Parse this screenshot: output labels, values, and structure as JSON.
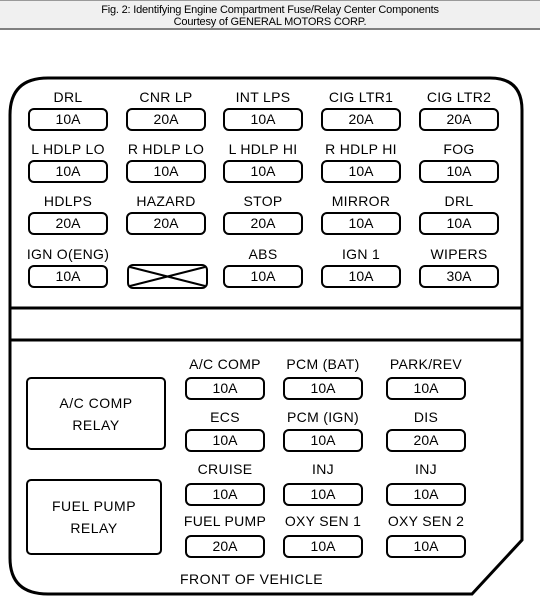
{
  "caption": {
    "title": "Fig. 2: Identifying Engine Compartment Fuse/Relay Center Components",
    "credit": "Courtesy of GENERAL MOTORS CORP."
  },
  "upper_fuses": [
    {
      "label": "DRL",
      "rating": "10A"
    },
    {
      "label": "CNR LP",
      "rating": "20A"
    },
    {
      "label": "INT LPS",
      "rating": "10A"
    },
    {
      "label": "CIG LTR1",
      "rating": "20A"
    },
    {
      "label": "CIG LTR2",
      "rating": "20A"
    },
    {
      "label": "L HDLP LO",
      "rating": "10A"
    },
    {
      "label": "R HDLP LO",
      "rating": "10A"
    },
    {
      "label": "L HDLP HI",
      "rating": "10A"
    },
    {
      "label": "R HDLP HI",
      "rating": "10A"
    },
    {
      "label": "FOG",
      "rating": "10A"
    },
    {
      "label": "HDLPS",
      "rating": "20A"
    },
    {
      "label": "HAZARD",
      "rating": "20A"
    },
    {
      "label": "STOP",
      "rating": "20A"
    },
    {
      "label": "MIRROR",
      "rating": "10A"
    },
    {
      "label": "DRL",
      "rating": "10A"
    },
    {
      "label": "IGN O(ENG)",
      "rating": "10A"
    },
    {
      "label": "",
      "rating": "",
      "empty": true
    },
    {
      "label": "ABS",
      "rating": "10A"
    },
    {
      "label": "IGN 1",
      "rating": "10A"
    },
    {
      "label": "WIPERS",
      "rating": "30A"
    }
  ],
  "lower_fuses": [
    {
      "label": "A/C COMP",
      "rating": "10A"
    },
    {
      "label": "PCM (BAT)",
      "rating": "10A"
    },
    {
      "label": "PARK/REV",
      "rating": "10A"
    },
    {
      "label": "ECS",
      "rating": "10A"
    },
    {
      "label": "PCM (IGN)",
      "rating": "10A"
    },
    {
      "label": "DIS",
      "rating": "20A"
    },
    {
      "label": "CRUISE",
      "rating": "10A"
    },
    {
      "label": "INJ",
      "rating": "10A"
    },
    {
      "label": "INJ",
      "rating": "10A"
    },
    {
      "label": "FUEL PUMP",
      "rating": "20A"
    },
    {
      "label": "OXY SEN 1",
      "rating": "10A"
    },
    {
      "label": "OXY SEN 2",
      "rating": "10A"
    }
  ],
  "relays": [
    {
      "line1": "A/C COMP",
      "line2": "RELAY"
    },
    {
      "line1": "FUEL PUMP",
      "line2": "RELAY"
    }
  ],
  "footer": "FRONT OF VEHICLE"
}
